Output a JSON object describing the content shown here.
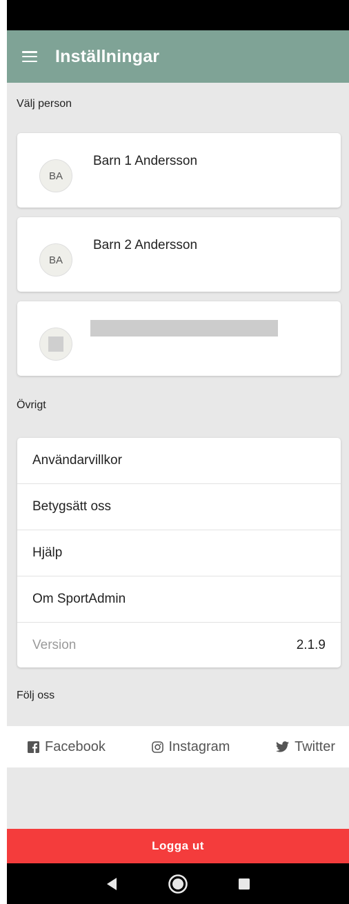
{
  "app_bar": {
    "title": "Inställningar",
    "color": "#7fa396"
  },
  "sections": {
    "persons": "Välj person",
    "other": "Övrigt",
    "follow": "Följ oss"
  },
  "persons": [
    {
      "initials": "BA",
      "name": "Barn 1 Andersson"
    },
    {
      "initials": "BA",
      "name": "Barn 2 Andersson"
    }
  ],
  "menu": {
    "terms": "Användarvillkor",
    "rate": "Betygsätt oss",
    "help": "Hjälp",
    "about": "Om SportAdmin",
    "version_label": "Version",
    "version_value": "2.1.9"
  },
  "social": {
    "facebook": "Facebook",
    "instagram": "Instagram",
    "twitter": "Twitter"
  },
  "logout": {
    "label": "Logga ut",
    "color": "#f43c3c"
  },
  "icons": [
    "menu-icon",
    "facebook-icon",
    "instagram-icon",
    "twitter-icon",
    "back-icon",
    "home-icon",
    "recents-icon"
  ]
}
